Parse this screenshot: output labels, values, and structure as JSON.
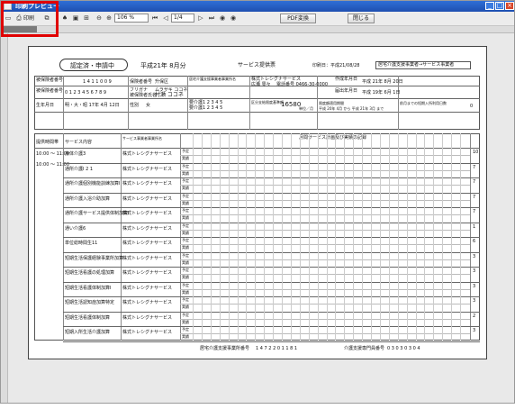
{
  "window": {
    "title": "印刷プレビュー",
    "min": "_",
    "max": "□",
    "close": "×"
  },
  "toolbar": {
    "print_label": "印刷",
    "zoom_value": "106 %",
    "page_value": "1/4",
    "pdf_label": "PDF変換",
    "close_label": "閉じる"
  },
  "doc": {
    "stamp": "認定済・申請中",
    "month": "平成21年 8月分",
    "heading": "サービス提供票",
    "print_date": "印刷日：平成21/08/28",
    "company_box": "居宅介護支援事業者→サービス事業者",
    "insured_no_label": "被保険者番号",
    "insured_no": "1 4 1 1 0 0 9",
    "insurer_label": "保険者番号",
    "insurer_name": "升保区",
    "office_label": "居宅介護支援事業者事業所名",
    "office_name": "株式トレシグナサービス",
    "office_person": "広瀬 零々",
    "office_tel": "電話番号 0466-30-0000",
    "created_label": "作成年月日",
    "created_date": "平成 21年 8月 20日",
    "insured_label": "被保険者番号",
    "insured_no2": "0 1 2 3 4 5 6 7 8 9",
    "kana_label": "フリガナ",
    "kana": "ムラサキ ココネ",
    "name_label": "被保険者氏名",
    "name": "村瀬 ココネ",
    "notify_label": "届出年月日",
    "notify_date": "平成 19年 6月 1日",
    "birth_label": "生年月日",
    "birth": "明・大・昭 17年 4月 12日",
    "sex_label": "性別",
    "sex": "女",
    "care_level": "要介護1 2 3 4 5",
    "care_level2": "要介護1 2 3 4 5",
    "limit_label": "区分支給限度基準額",
    "limit": "16580",
    "limit_unit": "単位／月",
    "period_label": "限度額適用期間",
    "period": "平成 20年 4月 から 平成 21年 3月 まで",
    "prev_label": "前月までの短期入所利用日数",
    "prev": "0",
    "table_header": "月間サービス計画及び実績の記録",
    "col_time": "提供時間帯",
    "col_service": "サービス内容",
    "col_office": "サービス事業者事業所名",
    "time1": "10:00 ～ 11:00",
    "time2": "10:00 ～ 11:00",
    "footer_label": "居宅介護支援事業所番号",
    "footer_no": "1 4 7 2 2 0 1 1 8 1",
    "footer_label2": "介護支援専門員番号",
    "footer_no2": "0 3 0 3 0 3 0 4"
  },
  "rows": [
    {
      "service": "身体介護3",
      "office": "株式トレシグナサービス"
    },
    {
      "service": "通所介護I 2 1",
      "office": "株式トレシグナサービス"
    },
    {
      "service": "通所介護個別機能訓練加算I",
      "office": "株式トレシグナサービス"
    },
    {
      "service": "通所介護入浴介助加算",
      "office": "株式トレシグナサービス"
    },
    {
      "service": "通所介護サービス提供体制加算I",
      "office": "株式トレシグナサービス"
    },
    {
      "service": "通い介護6",
      "office": "株式トレシグナサービス"
    },
    {
      "service": "単位総時間生11",
      "office": "株式トレシグナサービス"
    },
    {
      "service": "短期生活保護経験事業所加算",
      "office": "株式トレシグナサービス"
    },
    {
      "service": "短期生活看護の処理加算",
      "office": "株式トレシグナサービス"
    },
    {
      "service": "短期生活看護体制加算I",
      "office": "株式トレシグナサービス"
    },
    {
      "service": "短期生活認知症加算特定",
      "office": "株式トレシグナサービス"
    },
    {
      "service": "短期生活看護体制加算",
      "office": "株式トレシグナサービス"
    },
    {
      "service": "短期入所生活介護加算",
      "office": "株式トレシグナサービス"
    }
  ],
  "plan_labels": {
    "plan": "予定",
    "actual": "実績"
  },
  "totals": [
    "10",
    "7",
    "7",
    "7",
    "7",
    "1",
    "6",
    "3",
    "3",
    "3",
    "3",
    "2",
    "3"
  ]
}
